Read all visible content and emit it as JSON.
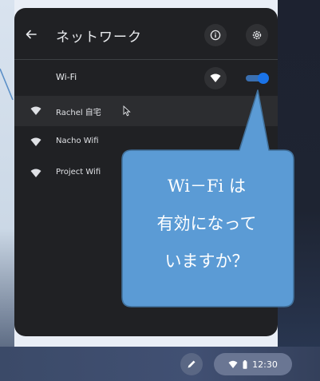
{
  "panel": {
    "title": "ネットワーク",
    "wifi_label": "Wi-Fi",
    "wifi_enabled": true,
    "networks": [
      {
        "name": "Rachel 自宅",
        "selected": true
      },
      {
        "name": "Nacho Wifi",
        "selected": false
      },
      {
        "name": "Project Wifi",
        "selected": false
      }
    ]
  },
  "callout": {
    "lines": [
      "Wi－Fi は",
      "有効になって",
      "いますか？"
    ]
  },
  "shelf": {
    "time": "12:30"
  },
  "colors": {
    "panel_bg": "#202124",
    "accent": "#1a73e8",
    "callout_fill": "#5b9bd5",
    "callout_stroke": "#41719c"
  }
}
